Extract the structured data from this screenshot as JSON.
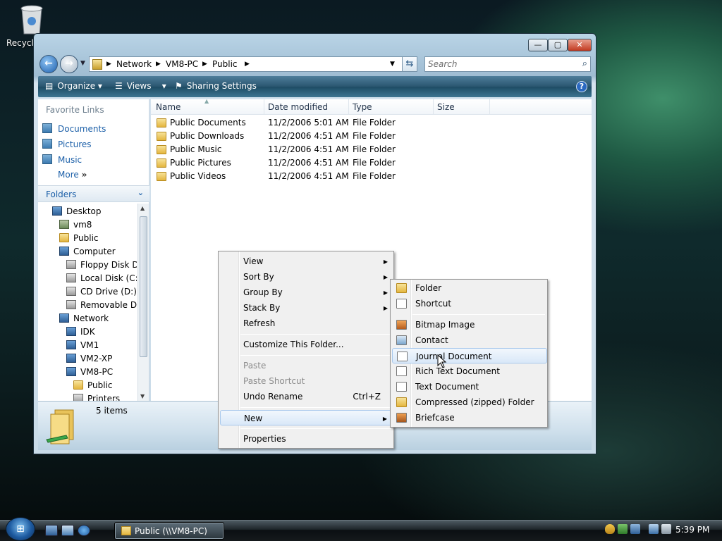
{
  "desktop": {
    "recycle_label": "Recycle"
  },
  "window": {
    "caption_buttons": {
      "minimize": "—",
      "maximize": "▢",
      "close": "✕"
    },
    "address": {
      "segments": [
        "Network",
        "VM8-PC",
        "Public"
      ]
    },
    "search_placeholder": "Search",
    "command_bar": {
      "organize": "Organize",
      "views": "Views",
      "sharing": "Sharing Settings",
      "help": "?"
    },
    "favorite_links": {
      "title": "Favorite Links",
      "items": [
        "Documents",
        "Pictures",
        "Music"
      ],
      "more": "More"
    },
    "folders": {
      "title": "Folders",
      "tree": [
        "Desktop",
        "vm8",
        "Public",
        "Computer",
        "Floppy Disk Dr",
        "Local Disk (C:)",
        "CD Drive (D:)",
        "Removable Dis",
        "Network",
        "IDK",
        "VM1",
        "VM2-XP",
        "VM8-PC",
        "Public",
        "Printers"
      ]
    },
    "columns": [
      "Name",
      "Date modified",
      "Type",
      "Size"
    ],
    "rows": [
      {
        "name": "Public Documents",
        "date": "11/2/2006 5:01 AM",
        "type": "File Folder"
      },
      {
        "name": "Public Downloads",
        "date": "11/2/2006 4:51 AM",
        "type": "File Folder"
      },
      {
        "name": "Public Music",
        "date": "11/2/2006 4:51 AM",
        "type": "File Folder"
      },
      {
        "name": "Public Pictures",
        "date": "11/2/2006 4:51 AM",
        "type": "File Folder"
      },
      {
        "name": "Public Videos",
        "date": "11/2/2006 4:51 AM",
        "type": "File Folder"
      }
    ],
    "details": {
      "count": "5 items"
    }
  },
  "context_menu": {
    "items": [
      "View",
      "Sort By",
      "Group By",
      "Stack By",
      "Refresh",
      "Customize This Folder...",
      "Paste",
      "Paste Shortcut",
      "Undo Rename",
      "New",
      "Properties"
    ],
    "undo_shortcut": "Ctrl+Z"
  },
  "new_submenu": {
    "items": [
      "Folder",
      "Shortcut",
      "Bitmap Image",
      "Contact",
      "Journal Document",
      "Rich Text Document",
      "Text Document",
      "Compressed (zipped) Folder",
      "Briefcase"
    ]
  },
  "taskbar": {
    "start_icon": "⊞",
    "task": "Public (\\\\VM8-PC)",
    "clock": "5:39 PM"
  },
  "colors": {
    "accent": "#1b5fa8",
    "command_bar": "#2a5670",
    "highlight": "#d9e8f8"
  }
}
